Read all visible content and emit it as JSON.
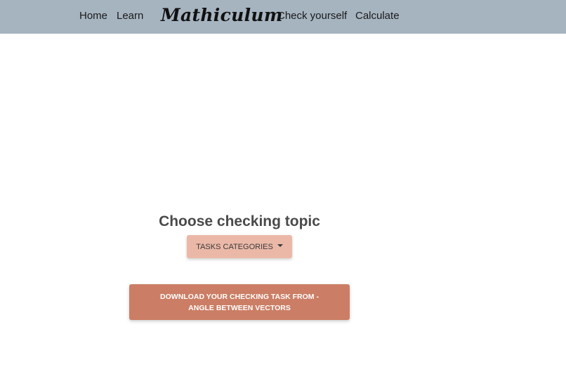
{
  "navbar": {
    "links_left": [
      "Home",
      "Learn"
    ],
    "brand": "Mathiculum",
    "links_right": [
      "Check yourself",
      "Calculate"
    ]
  },
  "main": {
    "title": "Choose checking topic",
    "dropdown_label": "TASKS CATEGORIES",
    "download_label": "DOWNLOAD YOUR CHECKING TASK FROM - ANGLE BETWEEN VECTORS"
  },
  "colors": {
    "navbar_bg": "#a6b4c0",
    "dropdown_bg": "#ebb8a8",
    "download_bg": "#cb7e65"
  }
}
